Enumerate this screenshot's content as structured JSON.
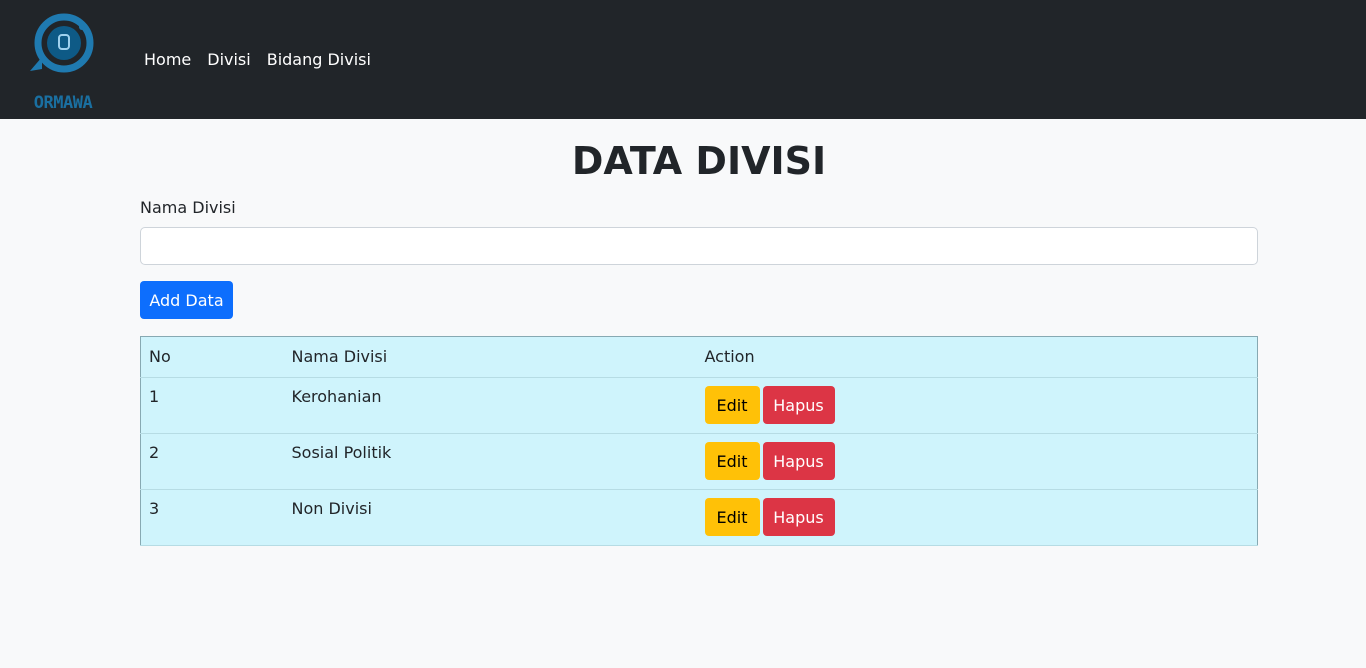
{
  "brand": {
    "name": "ORMAWA",
    "accent": "#1a6fa0"
  },
  "nav": {
    "items": [
      "Home",
      "Divisi",
      "Bidang Divisi"
    ]
  },
  "main": {
    "title": "DATA DIVISI",
    "form": {
      "label": "Nama Divisi",
      "value": "",
      "placeholder": "",
      "submit_label": "Add Data"
    },
    "table": {
      "headers": [
        "No",
        "Nama Divisi",
        "Action"
      ],
      "rows": [
        {
          "no": "1",
          "nama": "Kerohanian",
          "edit_label": "Edit",
          "delete_label": "Hapus"
        },
        {
          "no": "2",
          "nama": "Sosial Politik",
          "edit_label": "Edit",
          "delete_label": "Hapus"
        },
        {
          "no": "3",
          "nama": "Non Divisi",
          "edit_label": "Edit",
          "delete_label": "Hapus"
        }
      ]
    }
  },
  "colors": {
    "navbar": "#212529",
    "primary": "#0d6efd",
    "warning": "#ffc107",
    "danger": "#dc3545",
    "table_bg": "#cff4fc"
  }
}
